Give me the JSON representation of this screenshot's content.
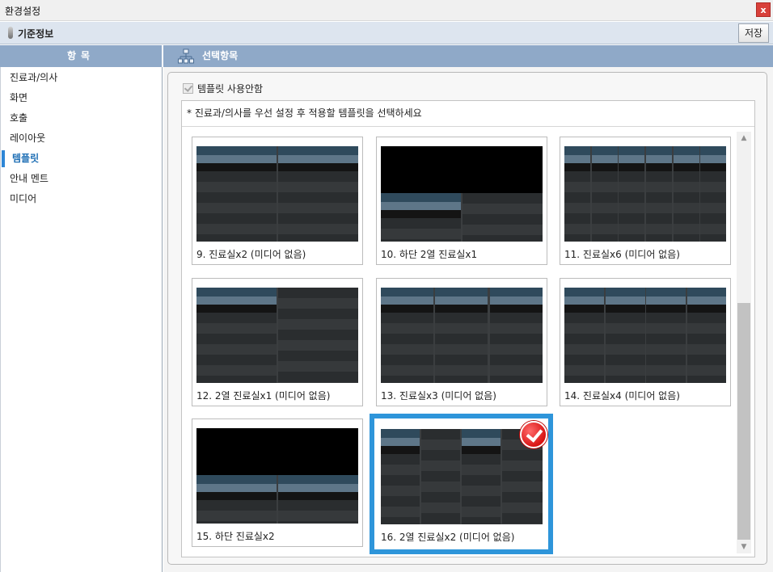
{
  "window": {
    "title": "환경설정",
    "close_label": "x"
  },
  "infobar": {
    "title": "기준정보",
    "save_label": "저장"
  },
  "left": {
    "header": "항목",
    "items": [
      {
        "label": "진료과/의사"
      },
      {
        "label": "화면"
      },
      {
        "label": "호출"
      },
      {
        "label": "레이아웃"
      },
      {
        "label": "템플릿",
        "active": true
      },
      {
        "label": "안내 멘트"
      },
      {
        "label": "미디어"
      }
    ]
  },
  "right": {
    "header": "선택항목",
    "checkbox_label": "템플릿 사용안함",
    "checkbox_checked": true,
    "instruction": "* 진료과/의사를 우선 설정 후 적용할 템플릿을 선택하세요"
  },
  "templates": [
    {
      "caption": "9. 진료실x2 (미디어 없음)",
      "layout": "cols2"
    },
    {
      "caption": "10. 하단 2열 진료실x1",
      "layout": "bottom2"
    },
    {
      "caption": "11. 진료실x6 (미디어 없음)",
      "layout": "cols6"
    },
    {
      "caption": "12. 2열 진료실x1 (미디어 없음)",
      "layout": "twoColOne"
    },
    {
      "caption": "13. 진료실x3 (미디어 없음)",
      "layout": "cols3"
    },
    {
      "caption": "14. 진료실x4 (미디어 없음)",
      "layout": "cols4"
    },
    {
      "caption": "15. 하단 진료실x2",
      "layout": "bottomCols2"
    },
    {
      "caption": "16. 2열 진료실x2 (미디어 없음)",
      "layout": "twoColTwo",
      "selected": true
    }
  ],
  "colors": {
    "accent": "#2e95da",
    "header_bg": "#8fa9c8",
    "thumb_header": "#5e7688",
    "thumb_dark": "#141414",
    "badge": "#d81414"
  },
  "icons": {
    "network": "network-icon",
    "check": "check-icon",
    "pin": "pin-icon"
  }
}
